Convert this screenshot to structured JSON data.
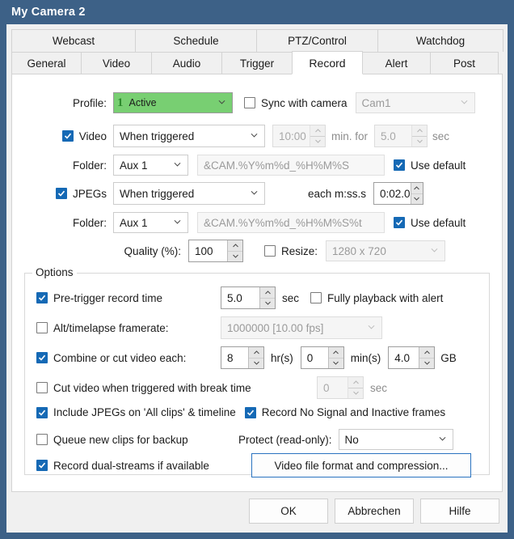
{
  "window": {
    "title": "My Camera 2"
  },
  "tabs": {
    "row1": [
      {
        "label": "Webcast",
        "selected": false
      },
      {
        "label": "Schedule",
        "selected": false
      },
      {
        "label": "PTZ/Control",
        "selected": false
      },
      {
        "label": "Watchdog",
        "selected": false
      }
    ],
    "row2": [
      {
        "label": "General",
        "selected": false
      },
      {
        "label": "Video",
        "selected": false
      },
      {
        "label": "Audio",
        "selected": false
      },
      {
        "label": "Trigger",
        "selected": false
      },
      {
        "label": "Record",
        "selected": true
      },
      {
        "label": "Alert",
        "selected": false
      },
      {
        "label": "Post",
        "selected": false
      }
    ]
  },
  "record": {
    "profile_label": "Profile:",
    "profile_number": "1",
    "profile_value": "Active",
    "sync_with_camera_label": "Sync with camera",
    "sync_with_camera_checked": false,
    "camera_value": "Cam1",
    "video_label": "Video",
    "video_checked": true,
    "video_mode": "When triggered",
    "video_time": "10:00",
    "video_min_for_label": "min. for",
    "video_duration": "5.0",
    "video_sec_label": "sec",
    "video_folder_label": "Folder:",
    "video_folder_value": "Aux 1",
    "video_folder_path": "&CAM.%Y%m%d_%H%M%S",
    "video_use_default_label": "Use default",
    "video_use_default_checked": true,
    "jpegs_label": "JPEGs",
    "jpegs_checked": true,
    "jpegs_mode": "When triggered",
    "jpegs_each_label": "each m:ss.s",
    "jpegs_each_value": "0:02.0",
    "jpegs_folder_label": "Folder:",
    "jpegs_folder_value": "Aux 1",
    "jpegs_folder_path": "&CAM.%Y%m%d_%H%M%S%t",
    "jpegs_use_default_label": "Use default",
    "jpegs_use_default_checked": true,
    "quality_label": "Quality (%):",
    "quality_value": "100",
    "resize_label": "Resize:",
    "resize_checked": false,
    "resize_value": "1280 x 720"
  },
  "options": {
    "group_title": "Options",
    "pretrigger_label": "Pre-trigger record time",
    "pretrigger_checked": true,
    "pretrigger_value": "5.0",
    "pretrigger_unit": "sec",
    "fully_playback_label": "Fully playback with alert",
    "fully_playback_checked": false,
    "alt_framerate_label": "Alt/timelapse framerate:",
    "alt_framerate_checked": false,
    "alt_framerate_value": "1000000 [10.00 fps]",
    "combine_label": "Combine or cut video each:",
    "combine_checked": true,
    "combine_hours": "8",
    "combine_hours_unit": "hr(s)",
    "combine_minutes": "0",
    "combine_minutes_unit": "min(s)",
    "combine_size": "4.0",
    "combine_size_unit": "GB",
    "cut_break_label": "Cut video when triggered with break time",
    "cut_break_checked": false,
    "cut_break_value": "0",
    "cut_break_unit": "sec",
    "include_jpegs_label": "Include JPEGs on 'All clips' & timeline",
    "include_jpegs_checked": true,
    "record_nosignal_label": "Record No Signal and Inactive frames",
    "record_nosignal_checked": true,
    "queue_backup_label": "Queue new clips for backup",
    "queue_backup_checked": false,
    "protect_label": "Protect (read-only):",
    "protect_value": "No",
    "dual_streams_label": "Record dual-streams if available",
    "dual_streams_checked": true,
    "video_format_button": "Video file format and compression..."
  },
  "footer": {
    "ok": "OK",
    "cancel": "Abbrechen",
    "help": "Hilfe"
  },
  "colors": {
    "titlebar": "#3d6187",
    "accent_checkbox": "#1569b5",
    "profile_active_green": "#78cf72",
    "focus_border": "#2a73c0"
  }
}
